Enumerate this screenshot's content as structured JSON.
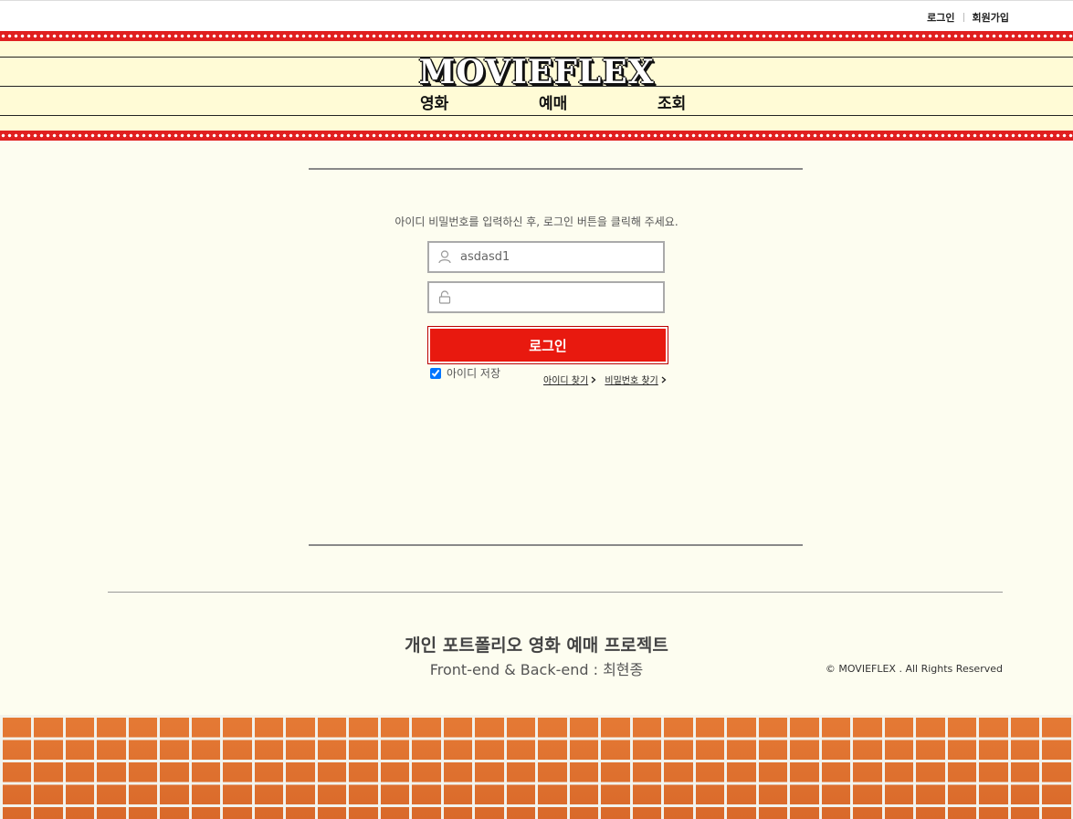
{
  "top_util": {
    "login": "로그인",
    "signup": "회원가입"
  },
  "header": {
    "logo": "MOVIEFLEX",
    "nav": [
      "영화",
      "예매",
      "조회"
    ]
  },
  "login": {
    "guide_text": "아이디 비밀번호를 입력하신 후, 로그인 버튼을 클릭해 주세요.",
    "id_value": "asdasd1",
    "password_value": "",
    "login_button": "로그인",
    "remember_label": "아이디 저장",
    "remember_checked": true,
    "find_id": "아이디 찾기",
    "find_password": "비밀번호 찾기"
  },
  "footer": {
    "title": "개인 포트폴리오 영화 예매 프로젝트",
    "subtitle": "Front-end & Back-end : 최현종",
    "copyright": "© MOVIEFLEX . All Rights Reserved"
  },
  "colors": {
    "accent_red": "#e8190f",
    "header_band": "#fffbd6",
    "page_bg": "#fdfdf0",
    "brick": "#e57a35"
  },
  "icons": [
    "user-icon",
    "lock-icon",
    "chevron-right-icon"
  ]
}
